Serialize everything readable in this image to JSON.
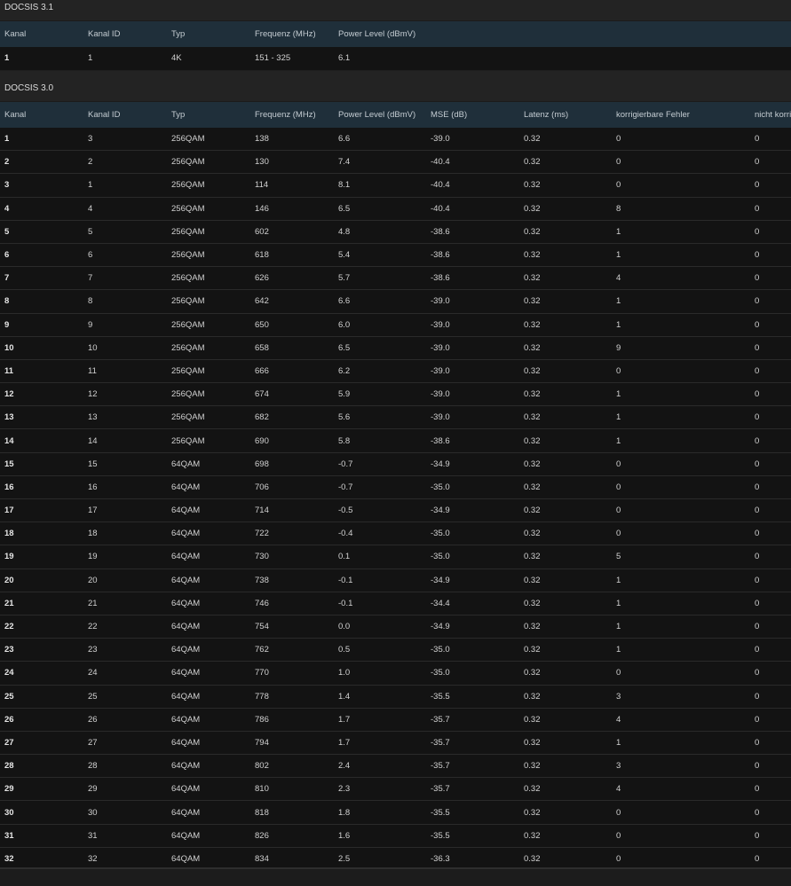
{
  "docsis31": {
    "title": "DOCSIS 3.1",
    "headers": [
      "Kanal",
      "Kanal ID",
      "Typ",
      "Frequenz (MHz)",
      "Power Level (dBmV)"
    ],
    "rows": [
      [
        "1",
        "1",
        "4K",
        "151 - 325",
        "6.1"
      ]
    ]
  },
  "docsis30": {
    "title": "DOCSIS 3.0",
    "headers": [
      "Kanal",
      "Kanal ID",
      "Typ",
      "Frequenz (MHz)",
      "Power Level (dBmV)",
      "MSE (dB)",
      "Latenz (ms)",
      "korrigierbare Fehler",
      "nicht korri"
    ],
    "rows": [
      [
        "1",
        "3",
        "256QAM",
        "138",
        "6.6",
        "-39.0",
        "0.32",
        "0",
        "0"
      ],
      [
        "2",
        "2",
        "256QAM",
        "130",
        "7.4",
        "-40.4",
        "0.32",
        "0",
        "0"
      ],
      [
        "3",
        "1",
        "256QAM",
        "114",
        "8.1",
        "-40.4",
        "0.32",
        "0",
        "0"
      ],
      [
        "4",
        "4",
        "256QAM",
        "146",
        "6.5",
        "-40.4",
        "0.32",
        "8",
        "0"
      ],
      [
        "5",
        "5",
        "256QAM",
        "602",
        "4.8",
        "-38.6",
        "0.32",
        "1",
        "0"
      ],
      [
        "6",
        "6",
        "256QAM",
        "618",
        "5.4",
        "-38.6",
        "0.32",
        "1",
        "0"
      ],
      [
        "7",
        "7",
        "256QAM",
        "626",
        "5.7",
        "-38.6",
        "0.32",
        "4",
        "0"
      ],
      [
        "8",
        "8",
        "256QAM",
        "642",
        "6.6",
        "-39.0",
        "0.32",
        "1",
        "0"
      ],
      [
        "9",
        "9",
        "256QAM",
        "650",
        "6.0",
        "-39.0",
        "0.32",
        "1",
        "0"
      ],
      [
        "10",
        "10",
        "256QAM",
        "658",
        "6.5",
        "-39.0",
        "0.32",
        "9",
        "0"
      ],
      [
        "11",
        "11",
        "256QAM",
        "666",
        "6.2",
        "-39.0",
        "0.32",
        "0",
        "0"
      ],
      [
        "12",
        "12",
        "256QAM",
        "674",
        "5.9",
        "-39.0",
        "0.32",
        "1",
        "0"
      ],
      [
        "13",
        "13",
        "256QAM",
        "682",
        "5.6",
        "-39.0",
        "0.32",
        "1",
        "0"
      ],
      [
        "14",
        "14",
        "256QAM",
        "690",
        "5.8",
        "-38.6",
        "0.32",
        "1",
        "0"
      ],
      [
        "15",
        "15",
        "64QAM",
        "698",
        "-0.7",
        "-34.9",
        "0.32",
        "0",
        "0"
      ],
      [
        "16",
        "16",
        "64QAM",
        "706",
        "-0.7",
        "-35.0",
        "0.32",
        "0",
        "0"
      ],
      [
        "17",
        "17",
        "64QAM",
        "714",
        "-0.5",
        "-34.9",
        "0.32",
        "0",
        "0"
      ],
      [
        "18",
        "18",
        "64QAM",
        "722",
        "-0.4",
        "-35.0",
        "0.32",
        "0",
        "0"
      ],
      [
        "19",
        "19",
        "64QAM",
        "730",
        "0.1",
        "-35.0",
        "0.32",
        "5",
        "0"
      ],
      [
        "20",
        "20",
        "64QAM",
        "738",
        "-0.1",
        "-34.9",
        "0.32",
        "1",
        "0"
      ],
      [
        "21",
        "21",
        "64QAM",
        "746",
        "-0.1",
        "-34.4",
        "0.32",
        "1",
        "0"
      ],
      [
        "22",
        "22",
        "64QAM",
        "754",
        "0.0",
        "-34.9",
        "0.32",
        "1",
        "0"
      ],
      [
        "23",
        "23",
        "64QAM",
        "762",
        "0.5",
        "-35.0",
        "0.32",
        "1",
        "0"
      ],
      [
        "24",
        "24",
        "64QAM",
        "770",
        "1.0",
        "-35.0",
        "0.32",
        "0",
        "0"
      ],
      [
        "25",
        "25",
        "64QAM",
        "778",
        "1.4",
        "-35.5",
        "0.32",
        "3",
        "0"
      ],
      [
        "26",
        "26",
        "64QAM",
        "786",
        "1.7",
        "-35.7",
        "0.32",
        "4",
        "0"
      ],
      [
        "27",
        "27",
        "64QAM",
        "794",
        "1.7",
        "-35.7",
        "0.32",
        "1",
        "0"
      ],
      [
        "28",
        "28",
        "64QAM",
        "802",
        "2.4",
        "-35.7",
        "0.32",
        "3",
        "0"
      ],
      [
        "29",
        "29",
        "64QAM",
        "810",
        "2.3",
        "-35.7",
        "0.32",
        "4",
        "0"
      ],
      [
        "30",
        "30",
        "64QAM",
        "818",
        "1.8",
        "-35.5",
        "0.32",
        "0",
        "0"
      ],
      [
        "31",
        "31",
        "64QAM",
        "826",
        "1.6",
        "-35.5",
        "0.32",
        "0",
        "0"
      ],
      [
        "32",
        "32",
        "64QAM",
        "834",
        "2.5",
        "-36.3",
        "0.32",
        "0",
        "0"
      ]
    ]
  }
}
